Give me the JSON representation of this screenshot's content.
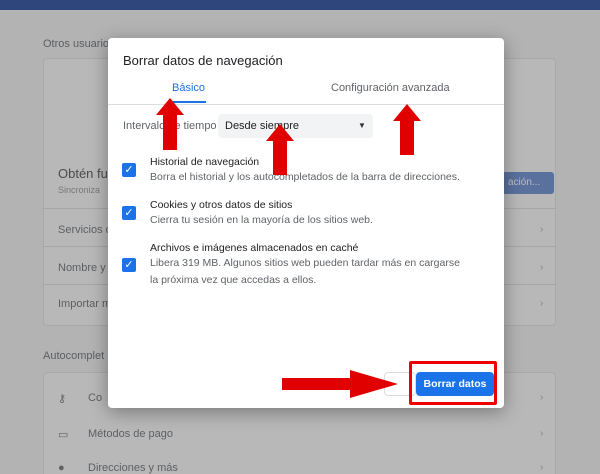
{
  "background": {
    "section_other_users": "Otros usuarios",
    "account_name": "Obtén fu",
    "account_sub": "Sincroniza",
    "account_button": "ación...",
    "rows": [
      "Servicios de",
      "Nombre y f",
      "Importar m"
    ],
    "section_autofill": "Autocomplet",
    "autofill_rows": [
      "Co",
      "Métodos de pago",
      "Direcciones y más"
    ]
  },
  "dialog": {
    "title": "Borrar datos de navegación",
    "tabs": [
      {
        "label": "Básico",
        "active": true
      },
      {
        "label": "Configuración avanzada",
        "active": false
      }
    ],
    "time_range_label": "Intervalo de tiempo",
    "time_range_value": "Desde siempre",
    "items": [
      {
        "title": "Historial de navegación",
        "description": "Borra el historial y los autocompletados de la barra de direcciones.",
        "checked": true
      },
      {
        "title": "Cookies y otros datos de sitios",
        "description": "Cierra tu sesión en la mayoría de los sitios web.",
        "checked": true
      },
      {
        "title": "Archivos e imágenes almacenados en caché",
        "description": "Libera 319 MB. Algunos sitios web pueden tardar más en cargarse la próxima vez que accedas a ellos.",
        "checked": true
      }
    ],
    "cancel_label": "",
    "confirm_label": "Borrar datos"
  },
  "colors": {
    "accent": "#1a73e8",
    "annotation_red": "#e00000"
  },
  "icons": {
    "caret": "chevron-down-icon",
    "check": "checkmark-icon",
    "arrow": "red-arrow-annotation"
  }
}
